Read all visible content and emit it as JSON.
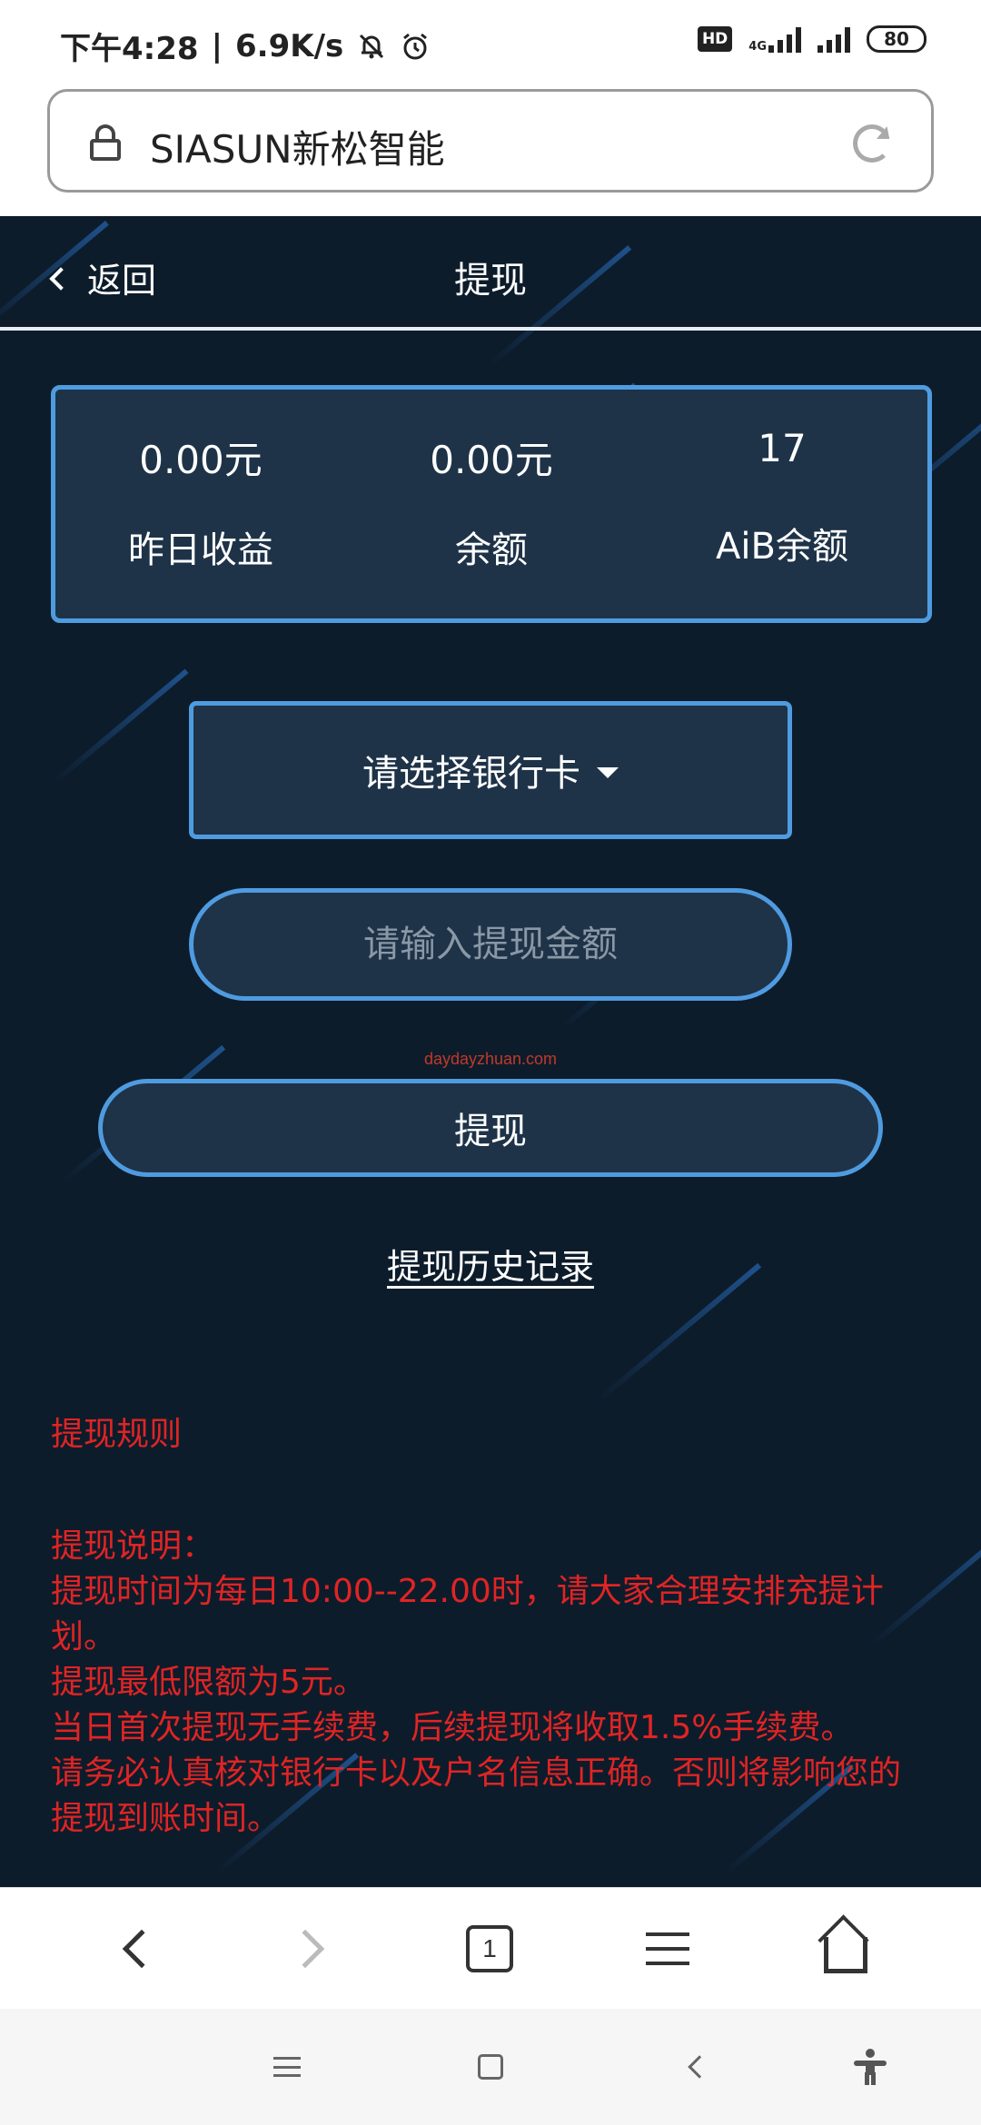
{
  "status_bar": {
    "time": "下午4:28",
    "speed": "6.9K/s",
    "hd_label": "HD",
    "network": "4G",
    "battery": "80"
  },
  "address_bar": {
    "site_title": "SIASUN新松智能"
  },
  "page": {
    "back_label": "返回",
    "title": "提现",
    "stats": [
      {
        "value": "0.00元",
        "label": "昨日收益"
      },
      {
        "value": "0.00元",
        "label": "余额"
      },
      {
        "value": "17",
        "label": "AiB余额"
      }
    ],
    "bank_select_label": "请选择银行卡",
    "amount_placeholder": "请输入提现金额",
    "watermark": "daydayzhuan.com",
    "withdraw_button": "提现",
    "history_link": "提现历史记录",
    "rules_title": "提现规则",
    "rules_lines": [
      "提现说明：",
      "提现时间为每日10:00--22.00时，请大家合理安排充提计划。",
      "提现最低限额为5元。",
      "当日首次提现无手续费，后续提现将收取1.5%手续费。",
      "请务必认真核对银行卡以及户名信息正确。否则将影响您的提现到账时间。"
    ]
  },
  "toolbar": {
    "tab_count": "1",
    "icons": [
      "back-icon",
      "forward-icon",
      "tabs-icon",
      "menu-icon",
      "home-icon"
    ]
  },
  "system_nav": {
    "icons": [
      "recents-icon",
      "home-square-icon",
      "system-back-icon",
      "accessibility-icon"
    ]
  },
  "colors": {
    "page_background": "#0d1c2b",
    "card_background": "#1e3348",
    "card_border": "#4f9be0",
    "rules_text": "#e02424"
  }
}
